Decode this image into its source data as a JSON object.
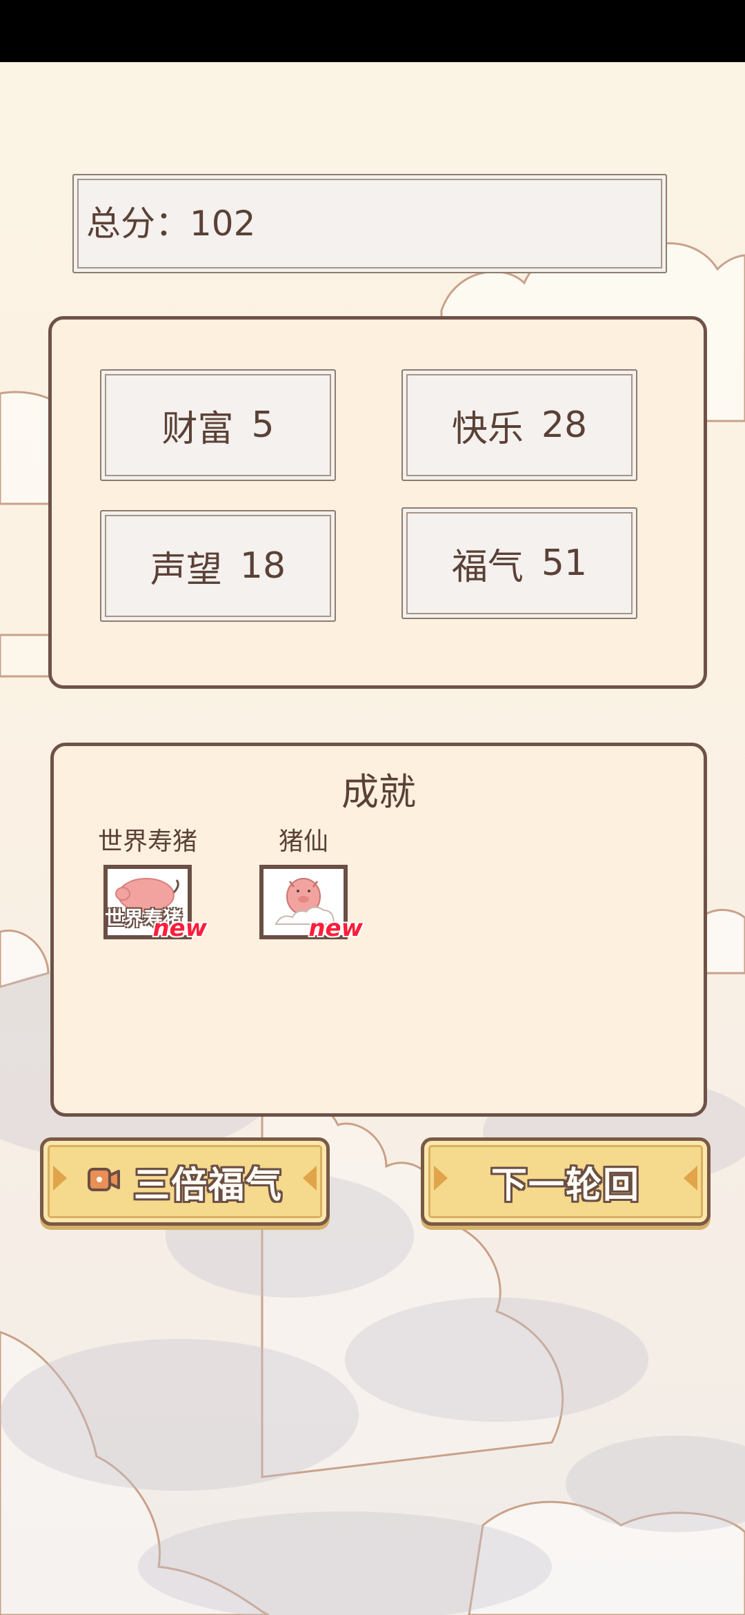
{
  "score": {
    "label": "总分：",
    "value": "102"
  },
  "stats": [
    {
      "name": "财富",
      "value": "5"
    },
    {
      "name": "快乐",
      "value": "28"
    },
    {
      "name": "声望",
      "value": "18"
    },
    {
      "name": "福气",
      "value": "51"
    }
  ],
  "achievements": {
    "title": "成就",
    "items": [
      {
        "label": "世界寿猪",
        "icon": "pig-icon",
        "icon_caption": "世界寿猪",
        "badge": "new"
      },
      {
        "label": "猪仙",
        "icon": "cloud-pig-icon",
        "badge": "new"
      }
    ]
  },
  "buttons": {
    "triple_label": "三倍福气",
    "triple_icon": "video-icon",
    "next_label": "下一轮回"
  },
  "colors": {
    "text_brown": "#5a4036",
    "button_yellow": "#f5d98c",
    "new_badge_red": "#ff1d3a",
    "pig_pink": "#f2a3a0"
  }
}
